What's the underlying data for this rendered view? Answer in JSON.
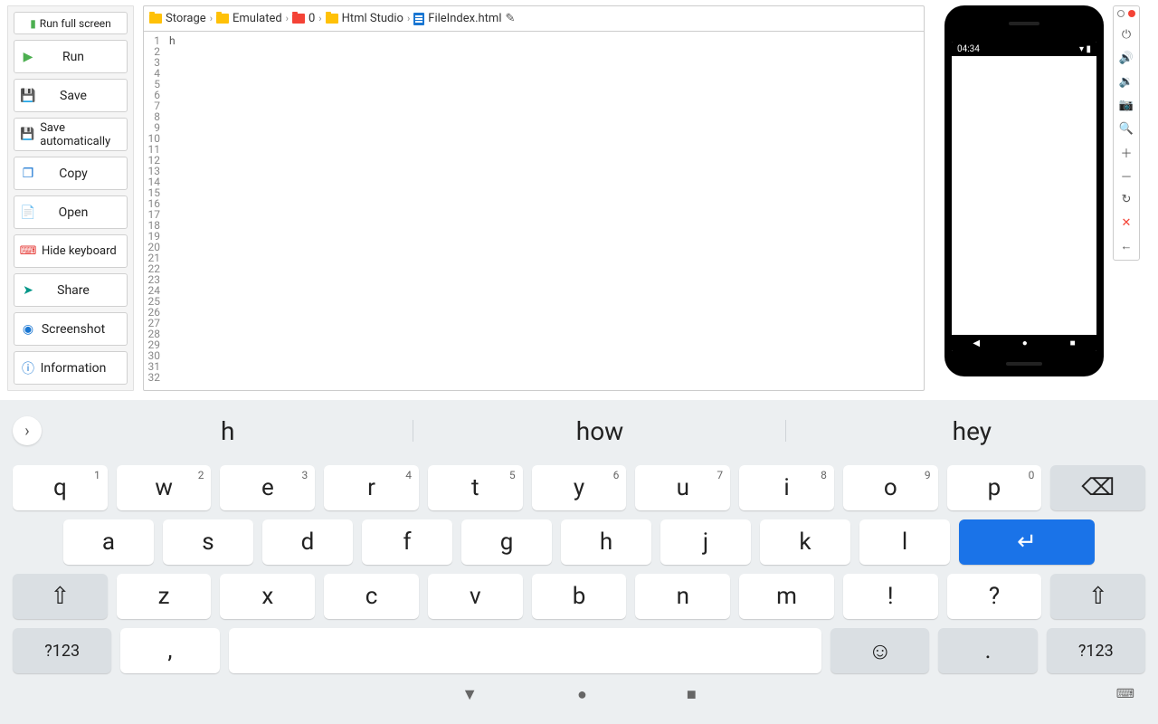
{
  "sidebar": {
    "fullscreen": "Run full screen",
    "run": "Run",
    "save": "Save",
    "auto": "Save automatically",
    "copy": "Copy",
    "open": "Open",
    "hidekb": "Hide keyboard",
    "share": "Share",
    "screenshot": "Screenshot",
    "info": "Information"
  },
  "breadcrumb": [
    "Storage",
    "Emulated",
    "0",
    "Html Studio",
    "FileIndex.html"
  ],
  "editor": {
    "content_line1": "h",
    "lines": 32
  },
  "phone": {
    "time": "04:34"
  },
  "suggestions": [
    "h",
    "how",
    "hey"
  ],
  "kb": {
    "row1": [
      {
        "k": "q",
        "n": "1"
      },
      {
        "k": "w",
        "n": "2"
      },
      {
        "k": "e",
        "n": "3"
      },
      {
        "k": "r",
        "n": "4"
      },
      {
        "k": "t",
        "n": "5"
      },
      {
        "k": "y",
        "n": "6"
      },
      {
        "k": "u",
        "n": "7"
      },
      {
        "k": "i",
        "n": "8"
      },
      {
        "k": "o",
        "n": "9"
      },
      {
        "k": "p",
        "n": "0"
      }
    ],
    "row2": [
      "a",
      "s",
      "d",
      "f",
      "g",
      "h",
      "j",
      "k",
      "l"
    ],
    "row3": [
      "z",
      "x",
      "c",
      "v",
      "b",
      "n",
      "m",
      "!",
      "?"
    ],
    "sym": "?123",
    "comma": ",",
    "period": "."
  }
}
